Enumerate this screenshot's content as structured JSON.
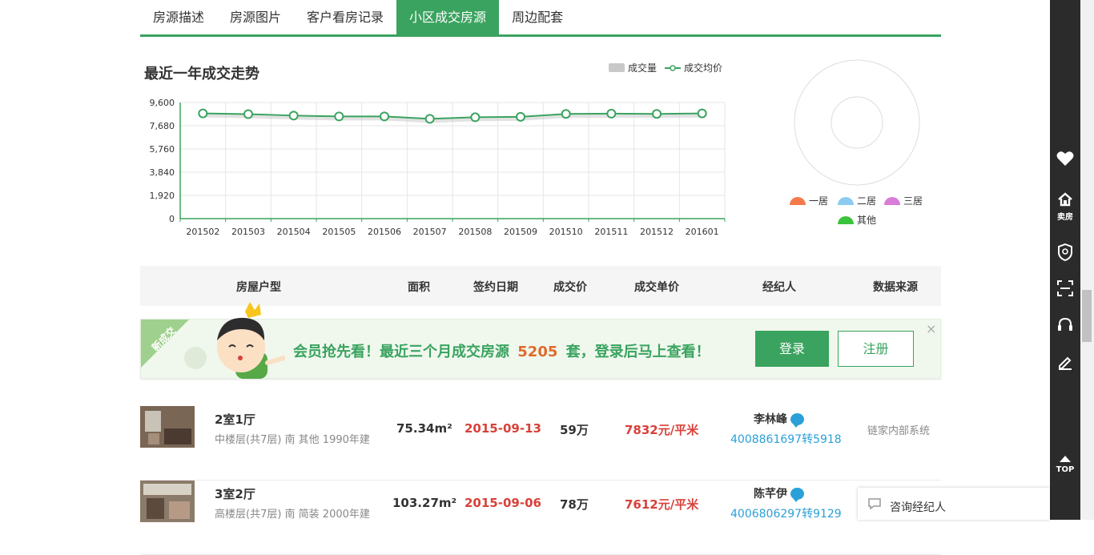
{
  "tabs": [
    {
      "label": "房源描述",
      "active": false
    },
    {
      "label": "房源图片",
      "active": false
    },
    {
      "label": "客户看房记录",
      "active": false
    },
    {
      "label": "小区成交房源",
      "active": true
    },
    {
      "label": "周边配套",
      "active": false
    }
  ],
  "chart": {
    "title": "最近一年成交走势",
    "legend_volume": "成交量",
    "legend_avg": "成交均价"
  },
  "chart_data": {
    "type": "line",
    "title": "最近一年成交走势",
    "categories": [
      "201502",
      "201503",
      "201504",
      "201505",
      "201506",
      "201507",
      "201508",
      "201509",
      "201510",
      "201511",
      "201512",
      "201601"
    ],
    "series": [
      {
        "name": "成交均价",
        "values": [
          8700,
          8640,
          8520,
          8450,
          8450,
          8250,
          8380,
          8420,
          8660,
          8680,
          8660,
          8700
        ]
      }
    ],
    "yticks": [
      "9,600",
      "7,680",
      "5,760",
      "3,840",
      "1,920",
      "0"
    ],
    "ylim": [
      0,
      9600
    ],
    "grid": true,
    "legend": "top-right"
  },
  "donut": {
    "legend": [
      "一居",
      "二居",
      "三居",
      "其他"
    ],
    "colors": [
      "#f4794b",
      "#8ccbf2",
      "#d97bd8",
      "#3cc33c"
    ]
  },
  "table_header": [
    "房屋户型",
    "面积",
    "签约日期",
    "成交价",
    "成交单价",
    "经纪人",
    "数据来源"
  ],
  "promo": {
    "ribbon": "新成交",
    "text_before": "会员抢先看！最近三个月成交房源",
    "count": "5205",
    "text_after": "套，登录后马上查看！",
    "login": "登录",
    "register": "注册",
    "close": "×"
  },
  "rows": [
    {
      "layout": "2室1厅",
      "sub": "中楼层(共7层) 南 其他 1990年建",
      "area": "75.34m²",
      "date": "2015-09-13",
      "price": "59万",
      "unit_price": "7832元/平米",
      "agent": "李林峰",
      "phone": "4008861697转5918",
      "source": "链家内部系统"
    },
    {
      "layout": "3室2厅",
      "sub": "高楼层(共7层) 南 简装 2000年建",
      "area": "103.27m²",
      "date": "2015-09-06",
      "price": "78万",
      "unit_price": "7612元/平米",
      "agent": "陈芊伊",
      "phone": "4006806297转9129",
      "source": ""
    }
  ],
  "sidebar": {
    "sell_label": "卖房",
    "top_label": "TOP"
  },
  "consult": {
    "label": "咨询经纪人"
  }
}
